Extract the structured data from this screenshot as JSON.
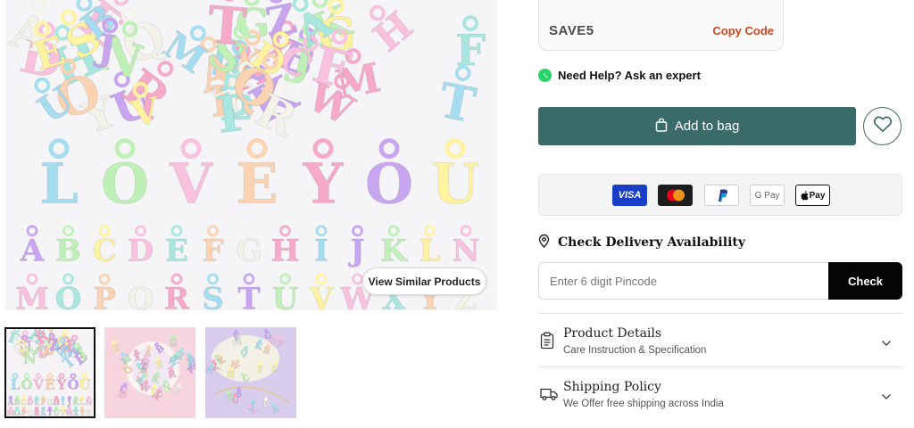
{
  "gallery": {
    "view_similar_label": "View Similar Products",
    "main_letters_row1": [
      "L",
      "O",
      "V",
      "E",
      "Y",
      "O",
      "U"
    ],
    "main_letters_row2": [
      "A",
      "B",
      "C",
      "D",
      "E",
      "F",
      "G",
      "H",
      "I",
      "J",
      "K",
      "L",
      "N"
    ],
    "main_letters_row3": [
      "M",
      "O",
      "P",
      "Q",
      "R",
      "S",
      "T",
      "U",
      "V",
      "W",
      "X",
      "Y",
      "Z"
    ],
    "pastel_colors": [
      "#f6a9c9",
      "#a6dcf0",
      "#c7a6ef",
      "#bff0b8",
      "#fff3a0",
      "#f8c1dd",
      "#a9e6e0",
      "#fbd2b2",
      "#f3f3ea"
    ]
  },
  "coupon": {
    "code": "SAVE5",
    "copy_label": "Copy Code"
  },
  "help": {
    "icon": "whatsapp-icon",
    "label": "Need Help? Ask an expert"
  },
  "cart": {
    "add_to_bag_label": "Add to bag",
    "bag_icon": "bag-icon",
    "wishlist_icon": "heart-icon",
    "accent_color": "#3a6b68"
  },
  "payments": {
    "visa_label": "VISA",
    "gpay_label": "G Pay",
    "apple_pay_label": "Pay",
    "methods": [
      "visa",
      "mastercard",
      "paypal",
      "google-pay",
      "apple-pay"
    ]
  },
  "delivery": {
    "title": "Check Delivery Availability",
    "pincode_placeholder": "Enter 6 digit Pincode",
    "check_label": "Check"
  },
  "accordions": [
    {
      "title": "Product Details",
      "subtitle": "Care Instruction & Specification",
      "icon": "clipboard-icon"
    },
    {
      "title": "Shipping Policy",
      "subtitle": "We Offer free shipping across India",
      "icon": "truck-icon"
    }
  ]
}
